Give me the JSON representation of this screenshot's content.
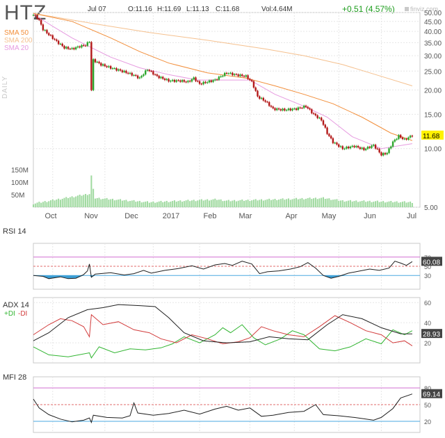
{
  "header": {
    "ticker": "HTZ",
    "date": "Jul 07",
    "open": "O:11.16",
    "high": "H:11.69",
    "low": "L:11.13",
    "close": "C:11.68",
    "volume": "Vol:4.64M",
    "change": "+0.51 (4.57%)",
    "watermark": "finviz.com",
    "timeframe": "DAILY"
  },
  "colors": {
    "sma50": "#f28e3a",
    "sma200": "#f5c08e",
    "sma20": "#e69be0",
    "up": "#2aa52a",
    "down": "#b31818",
    "rsi": "#1e1e1e",
    "oversold_fill": "#3d9fd6",
    "adx": "#1e1e1e",
    "plus_di": "#31b531",
    "minus_di": "#d23b3b",
    "mfi": "#1e1e1e",
    "price_badge": "#fff200",
    "change_green": "#1a9c1a"
  },
  "chart_data": [
    {
      "type": "candlestick",
      "panel": "price",
      "legend": [
        "SMA 50",
        "SMA 200",
        "SMA 20"
      ],
      "y_ticks": [
        "5.00",
        "10.00",
        "15.00",
        "20.00",
        "25.00",
        "30.00",
        "35.00",
        "40.00",
        "45.00",
        "50.00"
      ],
      "ylim": [
        5,
        50
      ],
      "x_ticks": [
        "Oct",
        "Nov",
        "Dec",
        "2017",
        "Feb",
        "Mar",
        "Apr",
        "May",
        "Jun",
        "Jul"
      ],
      "volume_ticks": [
        "150M",
        "100M",
        "50M"
      ],
      "last_price": "11.68",
      "price_path": [
        {
          "t": 0,
          "v": 48.5
        },
        {
          "t": 2,
          "v": 47.0
        },
        {
          "t": 3,
          "v": 45.5
        },
        {
          "t": 5,
          "v": 41.0
        },
        {
          "t": 8,
          "v": 38.5
        },
        {
          "t": 12,
          "v": 35.5
        },
        {
          "t": 16,
          "v": 33.0
        },
        {
          "t": 20,
          "v": 32.5
        },
        {
          "t": 24,
          "v": 33.5
        },
        {
          "t": 27,
          "v": 34.0
        },
        {
          "t": 29,
          "v": 35.5
        },
        {
          "t": 30,
          "v": 20.0
        },
        {
          "t": 31,
          "v": 28.5
        },
        {
          "t": 35,
          "v": 27.0
        },
        {
          "t": 40,
          "v": 26.0
        },
        {
          "t": 47,
          "v": 24.8
        },
        {
          "t": 52,
          "v": 23.8
        },
        {
          "t": 55,
          "v": 23.0
        },
        {
          "t": 59,
          "v": 25.5
        },
        {
          "t": 64,
          "v": 23.5
        },
        {
          "t": 70,
          "v": 22.3
        },
        {
          "t": 76,
          "v": 22.3
        },
        {
          "t": 80,
          "v": 22.0
        },
        {
          "t": 83,
          "v": 23.0
        },
        {
          "t": 86,
          "v": 21.5
        },
        {
          "t": 90,
          "v": 22.0
        },
        {
          "t": 94,
          "v": 22.5
        },
        {
          "t": 97,
          "v": 23.5
        },
        {
          "t": 100,
          "v": 24.5
        },
        {
          "t": 104,
          "v": 24.0
        },
        {
          "t": 110,
          "v": 23.5
        },
        {
          "t": 113,
          "v": 22.0
        },
        {
          "t": 116,
          "v": 18.5
        },
        {
          "t": 120,
          "v": 17.5
        },
        {
          "t": 124,
          "v": 16.0
        },
        {
          "t": 130,
          "v": 15.8
        },
        {
          "t": 136,
          "v": 16.0
        },
        {
          "t": 141,
          "v": 16.5
        },
        {
          "t": 145,
          "v": 15.0
        },
        {
          "t": 149,
          "v": 14.0
        },
        {
          "t": 152,
          "v": 12.0
        },
        {
          "t": 155,
          "v": 10.8
        },
        {
          "t": 160,
          "v": 10.0
        },
        {
          "t": 166,
          "v": 10.3
        },
        {
          "t": 171,
          "v": 9.9
        },
        {
          "t": 176,
          "v": 10.4
        },
        {
          "t": 180,
          "v": 9.3
        },
        {
          "t": 183,
          "v": 9.5
        },
        {
          "t": 186,
          "v": 10.8
        },
        {
          "t": 189,
          "v": 11.6
        },
        {
          "t": 192,
          "v": 11.1
        },
        {
          "t": 196,
          "v": 11.68
        }
      ],
      "sma20_path": [
        {
          "t": 0,
          "v": 49.0
        },
        {
          "t": 10,
          "v": 42.5
        },
        {
          "t": 20,
          "v": 37.0
        },
        {
          "t": 30,
          "v": 33.0
        },
        {
          "t": 40,
          "v": 29.5
        },
        {
          "t": 55,
          "v": 26.0
        },
        {
          "t": 70,
          "v": 24.0
        },
        {
          "t": 85,
          "v": 22.5
        },
        {
          "t": 100,
          "v": 22.5
        },
        {
          "t": 112,
          "v": 22.5
        },
        {
          "t": 125,
          "v": 19.0
        },
        {
          "t": 140,
          "v": 16.5
        },
        {
          "t": 152,
          "v": 14.5
        },
        {
          "t": 165,
          "v": 11.5
        },
        {
          "t": 180,
          "v": 10.0
        },
        {
          "t": 196,
          "v": 10.6
        }
      ],
      "sma50_path": [
        {
          "t": 0,
          "v": 49.5
        },
        {
          "t": 20,
          "v": 45.0
        },
        {
          "t": 40,
          "v": 37.0
        },
        {
          "t": 55,
          "v": 31.5
        },
        {
          "t": 70,
          "v": 27.5
        },
        {
          "t": 90,
          "v": 24.5
        },
        {
          "t": 110,
          "v": 23.0
        },
        {
          "t": 125,
          "v": 21.0
        },
        {
          "t": 140,
          "v": 19.0
        },
        {
          "t": 155,
          "v": 17.0
        },
        {
          "t": 170,
          "v": 14.5
        },
        {
          "t": 185,
          "v": 12.0
        },
        {
          "t": 196,
          "v": 11.0
        }
      ],
      "sma200_path": [
        {
          "t": 0,
          "v": 49.5
        },
        {
          "t": 30,
          "v": 44.0
        },
        {
          "t": 60,
          "v": 39.5
        },
        {
          "t": 90,
          "v": 36.0
        },
        {
          "t": 120,
          "v": 32.5
        },
        {
          "t": 140,
          "v": 30.0
        },
        {
          "t": 160,
          "v": 27.0
        },
        {
          "t": 180,
          "v": 23.5
        },
        {
          "t": 196,
          "v": 21.0
        }
      ],
      "volume_path": [
        {
          "t": 0,
          "v": 10
        },
        {
          "t": 29,
          "v": 45
        },
        {
          "t": 30,
          "v": 110
        },
        {
          "t": 31,
          "v": 60
        },
        {
          "t": 32,
          "v": 30
        },
        {
          "t": 60,
          "v": 15
        },
        {
          "t": 95,
          "v": 25
        },
        {
          "t": 100,
          "v": 20
        },
        {
          "t": 150,
          "v": 30
        },
        {
          "t": 160,
          "v": 20
        },
        {
          "t": 196,
          "v": 15
        }
      ]
    },
    {
      "type": "line",
      "panel": "rsi",
      "title": "RSI 14",
      "y_ticks": [
        "70",
        "50",
        "30"
      ],
      "ylim": [
        0,
        100
      ],
      "last_value": "60.08",
      "values": [
        {
          "t": 0,
          "v": 30
        },
        {
          "t": 5,
          "v": 28
        },
        {
          "t": 8,
          "v": 23
        },
        {
          "t": 14,
          "v": 27
        },
        {
          "t": 18,
          "v": 23
        },
        {
          "t": 22,
          "v": 24
        },
        {
          "t": 26,
          "v": 32
        },
        {
          "t": 28,
          "v": 40
        },
        {
          "t": 29,
          "v": 55
        },
        {
          "t": 30,
          "v": 26
        },
        {
          "t": 32,
          "v": 33
        },
        {
          "t": 40,
          "v": 36
        },
        {
          "t": 47,
          "v": 31
        },
        {
          "t": 52,
          "v": 34
        },
        {
          "t": 57,
          "v": 41
        },
        {
          "t": 61,
          "v": 35
        },
        {
          "t": 68,
          "v": 41
        },
        {
          "t": 75,
          "v": 45
        },
        {
          "t": 82,
          "v": 51
        },
        {
          "t": 88,
          "v": 44
        },
        {
          "t": 94,
          "v": 53
        },
        {
          "t": 99,
          "v": 56
        },
        {
          "t": 103,
          "v": 52
        },
        {
          "t": 108,
          "v": 61
        },
        {
          "t": 113,
          "v": 55
        },
        {
          "t": 117,
          "v": 34
        },
        {
          "t": 121,
          "v": 38
        },
        {
          "t": 127,
          "v": 40
        },
        {
          "t": 133,
          "v": 44
        },
        {
          "t": 138,
          "v": 49
        },
        {
          "t": 142,
          "v": 58
        },
        {
          "t": 146,
          "v": 46
        },
        {
          "t": 150,
          "v": 30
        },
        {
          "t": 154,
          "v": 24
        },
        {
          "t": 158,
          "v": 28
        },
        {
          "t": 163,
          "v": 35
        },
        {
          "t": 168,
          "v": 39
        },
        {
          "t": 174,
          "v": 44
        },
        {
          "t": 179,
          "v": 41
        },
        {
          "t": 184,
          "v": 46
        },
        {
          "t": 187,
          "v": 61
        },
        {
          "t": 190,
          "v": 57
        },
        {
          "t": 193,
          "v": 52
        },
        {
          "t": 196,
          "v": 60.08
        }
      ]
    },
    {
      "type": "line",
      "panel": "adx",
      "title": "ADX 14",
      "legend": [
        "+DI",
        "-DI"
      ],
      "y_ticks": [
        "60",
        "40",
        "20"
      ],
      "ylim": [
        0,
        65
      ],
      "last_value": "28.93",
      "series": [
        {
          "name": "ADX",
          "values": [
            {
              "t": 0,
              "v": 22
            },
            {
              "t": 8,
              "v": 30
            },
            {
              "t": 18,
              "v": 45
            },
            {
              "t": 28,
              "v": 53
            },
            {
              "t": 36,
              "v": 55
            },
            {
              "t": 44,
              "v": 58
            },
            {
              "t": 55,
              "v": 57
            },
            {
              "t": 63,
              "v": 56
            },
            {
              "t": 70,
              "v": 45
            },
            {
              "t": 78,
              "v": 30
            },
            {
              "t": 88,
              "v": 22
            },
            {
              "t": 100,
              "v": 20
            },
            {
              "t": 112,
              "v": 21
            },
            {
              "t": 122,
              "v": 26
            },
            {
              "t": 132,
              "v": 24
            },
            {
              "t": 142,
              "v": 23
            },
            {
              "t": 152,
              "v": 38
            },
            {
              "t": 160,
              "v": 48
            },
            {
              "t": 170,
              "v": 44
            },
            {
              "t": 180,
              "v": 35
            },
            {
              "t": 190,
              "v": 29
            },
            {
              "t": 196,
              "v": 28.93
            }
          ]
        },
        {
          "name": "+DI",
          "values": [
            {
              "t": 0,
              "v": 16
            },
            {
              "t": 8,
              "v": 8
            },
            {
              "t": 18,
              "v": 6
            },
            {
              "t": 29,
              "v": 10
            },
            {
              "t": 30,
              "v": 5
            },
            {
              "t": 34,
              "v": 16
            },
            {
              "t": 42,
              "v": 10
            },
            {
              "t": 50,
              "v": 14
            },
            {
              "t": 58,
              "v": 13
            },
            {
              "t": 66,
              "v": 15
            },
            {
              "t": 72,
              "v": 19
            },
            {
              "t": 78,
              "v": 26
            },
            {
              "t": 86,
              "v": 20
            },
            {
              "t": 94,
              "v": 28
            },
            {
              "t": 98,
              "v": 35
            },
            {
              "t": 102,
              "v": 30
            },
            {
              "t": 108,
              "v": 38
            },
            {
              "t": 114,
              "v": 25
            },
            {
              "t": 120,
              "v": 18
            },
            {
              "t": 128,
              "v": 24
            },
            {
              "t": 134,
              "v": 32
            },
            {
              "t": 140,
              "v": 28
            },
            {
              "t": 148,
              "v": 14
            },
            {
              "t": 156,
              "v": 12
            },
            {
              "t": 164,
              "v": 16
            },
            {
              "t": 172,
              "v": 24
            },
            {
              "t": 180,
              "v": 19
            },
            {
              "t": 186,
              "v": 33
            },
            {
              "t": 192,
              "v": 28
            },
            {
              "t": 196,
              "v": 32
            }
          ]
        },
        {
          "name": "-DI",
          "values": [
            {
              "t": 0,
              "v": 28
            },
            {
              "t": 8,
              "v": 38
            },
            {
              "t": 14,
              "v": 44
            },
            {
              "t": 20,
              "v": 42
            },
            {
              "t": 26,
              "v": 36
            },
            {
              "t": 29,
              "v": 26
            },
            {
              "t": 30,
              "v": 48
            },
            {
              "t": 36,
              "v": 38
            },
            {
              "t": 44,
              "v": 41
            },
            {
              "t": 52,
              "v": 33
            },
            {
              "t": 60,
              "v": 30
            },
            {
              "t": 66,
              "v": 24
            },
            {
              "t": 74,
              "v": 20
            },
            {
              "t": 82,
              "v": 28
            },
            {
              "t": 90,
              "v": 24
            },
            {
              "t": 98,
              "v": 19
            },
            {
              "t": 106,
              "v": 21
            },
            {
              "t": 112,
              "v": 25
            },
            {
              "t": 118,
              "v": 36
            },
            {
              "t": 124,
              "v": 32
            },
            {
              "t": 132,
              "v": 28
            },
            {
              "t": 140,
              "v": 26
            },
            {
              "t": 148,
              "v": 36
            },
            {
              "t": 156,
              "v": 47
            },
            {
              "t": 164,
              "v": 40
            },
            {
              "t": 172,
              "v": 32
            },
            {
              "t": 180,
              "v": 28
            },
            {
              "t": 186,
              "v": 20
            },
            {
              "t": 192,
              "v": 22
            },
            {
              "t": 196,
              "v": 17
            }
          ]
        }
      ]
    },
    {
      "type": "line",
      "panel": "mfi",
      "title": "MFI 28",
      "y_ticks": [
        "80",
        "50",
        "20"
      ],
      "ylim": [
        0,
        100
      ],
      "last_value": "69.14",
      "values": [
        {
          "t": 0,
          "v": 60
        },
        {
          "t": 3,
          "v": 44
        },
        {
          "t": 8,
          "v": 32
        },
        {
          "t": 14,
          "v": 24
        },
        {
          "t": 20,
          "v": 19
        },
        {
          "t": 26,
          "v": 22
        },
        {
          "t": 29,
          "v": 26
        },
        {
          "t": 30,
          "v": 18
        },
        {
          "t": 31,
          "v": 31
        },
        {
          "t": 38,
          "v": 27
        },
        {
          "t": 46,
          "v": 26
        },
        {
          "t": 50,
          "v": 30
        },
        {
          "t": 52,
          "v": 53
        },
        {
          "t": 54,
          "v": 35
        },
        {
          "t": 62,
          "v": 31
        },
        {
          "t": 70,
          "v": 34
        },
        {
          "t": 78,
          "v": 40
        },
        {
          "t": 86,
          "v": 33
        },
        {
          "t": 94,
          "v": 42
        },
        {
          "t": 100,
          "v": 47
        },
        {
          "t": 106,
          "v": 40
        },
        {
          "t": 112,
          "v": 44
        },
        {
          "t": 118,
          "v": 29
        },
        {
          "t": 124,
          "v": 31
        },
        {
          "t": 132,
          "v": 36
        },
        {
          "t": 140,
          "v": 38
        },
        {
          "t": 146,
          "v": 50
        },
        {
          "t": 150,
          "v": 32
        },
        {
          "t": 158,
          "v": 30
        },
        {
          "t": 166,
          "v": 27
        },
        {
          "t": 172,
          "v": 24
        },
        {
          "t": 176,
          "v": 22
        },
        {
          "t": 180,
          "v": 27
        },
        {
          "t": 186,
          "v": 43
        },
        {
          "t": 190,
          "v": 62
        },
        {
          "t": 196,
          "v": 69.14
        }
      ]
    }
  ]
}
